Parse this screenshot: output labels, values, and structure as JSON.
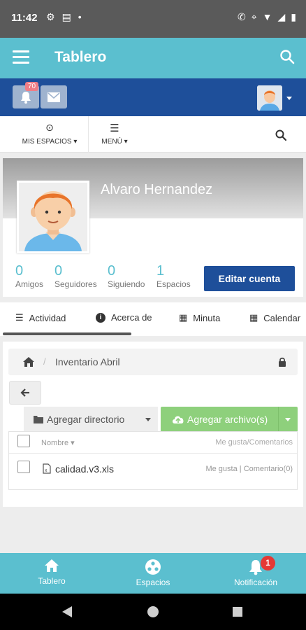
{
  "status_bar": {
    "time": "11:42"
  },
  "app_bar": {
    "title": "Tablero"
  },
  "top_bar": {
    "notification_count": "70"
  },
  "nav_row": {
    "spaces_label": "MIS ESPACIOS",
    "menu_label": "MENÚ"
  },
  "profile": {
    "name": "Alvaro Hernandez",
    "stats": [
      {
        "value": "0",
        "label": "Amigos"
      },
      {
        "value": "0",
        "label": "Seguidores"
      },
      {
        "value": "0",
        "label": "Siguiendo"
      },
      {
        "value": "1",
        "label": "Espacios"
      }
    ],
    "edit_button": "Editar cuenta"
  },
  "tabs": [
    {
      "label": "Actividad"
    },
    {
      "label": "Acerca de"
    },
    {
      "label": "Minuta"
    },
    {
      "label": "Calendar"
    }
  ],
  "breadcrumb": {
    "current": "Inventario Abril"
  },
  "toolbar": {
    "add_directory": "Agregar directorio",
    "add_file": "Agregar archivo(s)"
  },
  "file_table": {
    "col_name": "Nombre",
    "col_likes": "Me gusta/Comentarios",
    "rows": [
      {
        "name": "calidad.v3.xls",
        "likes": "Me gusta",
        "comments": "Comentario(0)"
      }
    ]
  },
  "bottom_nav": {
    "items": [
      {
        "label": "Tablero"
      },
      {
        "label": "Espacios"
      },
      {
        "label": "Notificación"
      }
    ],
    "notification_badge": "1"
  },
  "colors": {
    "teal": "#5bbfcf",
    "navy": "#1e4f9a",
    "green": "#8ed07c",
    "badge_red": "#e53935"
  }
}
